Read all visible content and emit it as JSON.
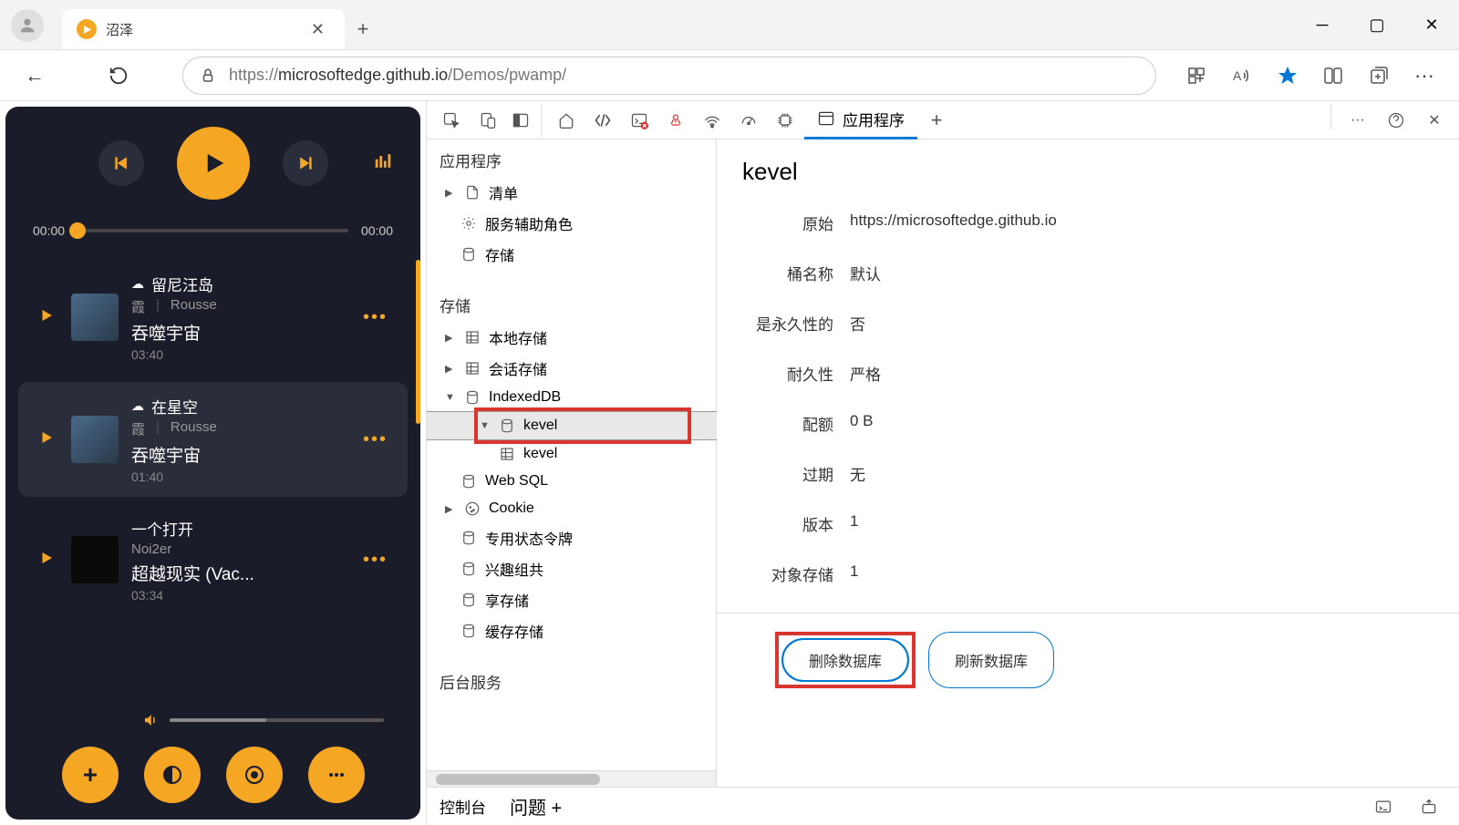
{
  "window": {
    "tab_title": "沼泽"
  },
  "toolbar": {
    "url_host": "microsoftedge.github.io",
    "url_prefix": "https://",
    "url_path": "/Demos/pwamp/"
  },
  "pwamp": {
    "time_current": "00:00",
    "time_total": "00:00",
    "tracks": [
      {
        "title": "留尼汪岛",
        "artist1": "霞",
        "artist2": "Rousse",
        "album": "吞噬宇宙",
        "duration": "03:40",
        "art": "blue"
      },
      {
        "title": "在星空",
        "artist1": "霞",
        "artist2": "Rousse",
        "album": "吞噬宇宙",
        "duration": "01:40",
        "art": "blue"
      },
      {
        "title": "一个打开",
        "artist1": "Noi2er",
        "artist2": "",
        "album": "超越现实 (Vac...",
        "duration": "03:34",
        "art": "dark"
      }
    ]
  },
  "devtools": {
    "active_tab": "应用程序",
    "sidebar": {
      "section_app": "应用程序",
      "section_storage": "存储",
      "section_backend": "后台服务",
      "items_app": [
        "清单",
        "服务辅助角色",
        "存储"
      ],
      "items_storage": [
        "本地存储",
        "会话存储",
        "IndexedDB",
        "Web SQL",
        "Cookie",
        "专用状态令牌",
        "兴趣组共",
        "享存储",
        "缓存存储"
      ],
      "indexeddb_db": "kevel",
      "indexeddb_store": "kevel"
    },
    "detail": {
      "heading": "kevel",
      "rows": [
        {
          "k": "原始",
          "v": "https://microsoftedge.github.io"
        },
        {
          "k": "桶名称",
          "v": "默认"
        },
        {
          "k": "是永久性的",
          "v": "否"
        },
        {
          "k": "耐久性",
          "v": "严格"
        },
        {
          "k": "配额",
          "v": "0 B"
        },
        {
          "k": "过期",
          "v": "无"
        },
        {
          "k": "版本",
          "v": "1"
        },
        {
          "k": "对象存储",
          "v": "1"
        }
      ],
      "btn_delete": "删除数据库",
      "btn_refresh": "刷新数据库"
    },
    "footer": {
      "console": "控制台",
      "issues": "问题 +"
    }
  }
}
